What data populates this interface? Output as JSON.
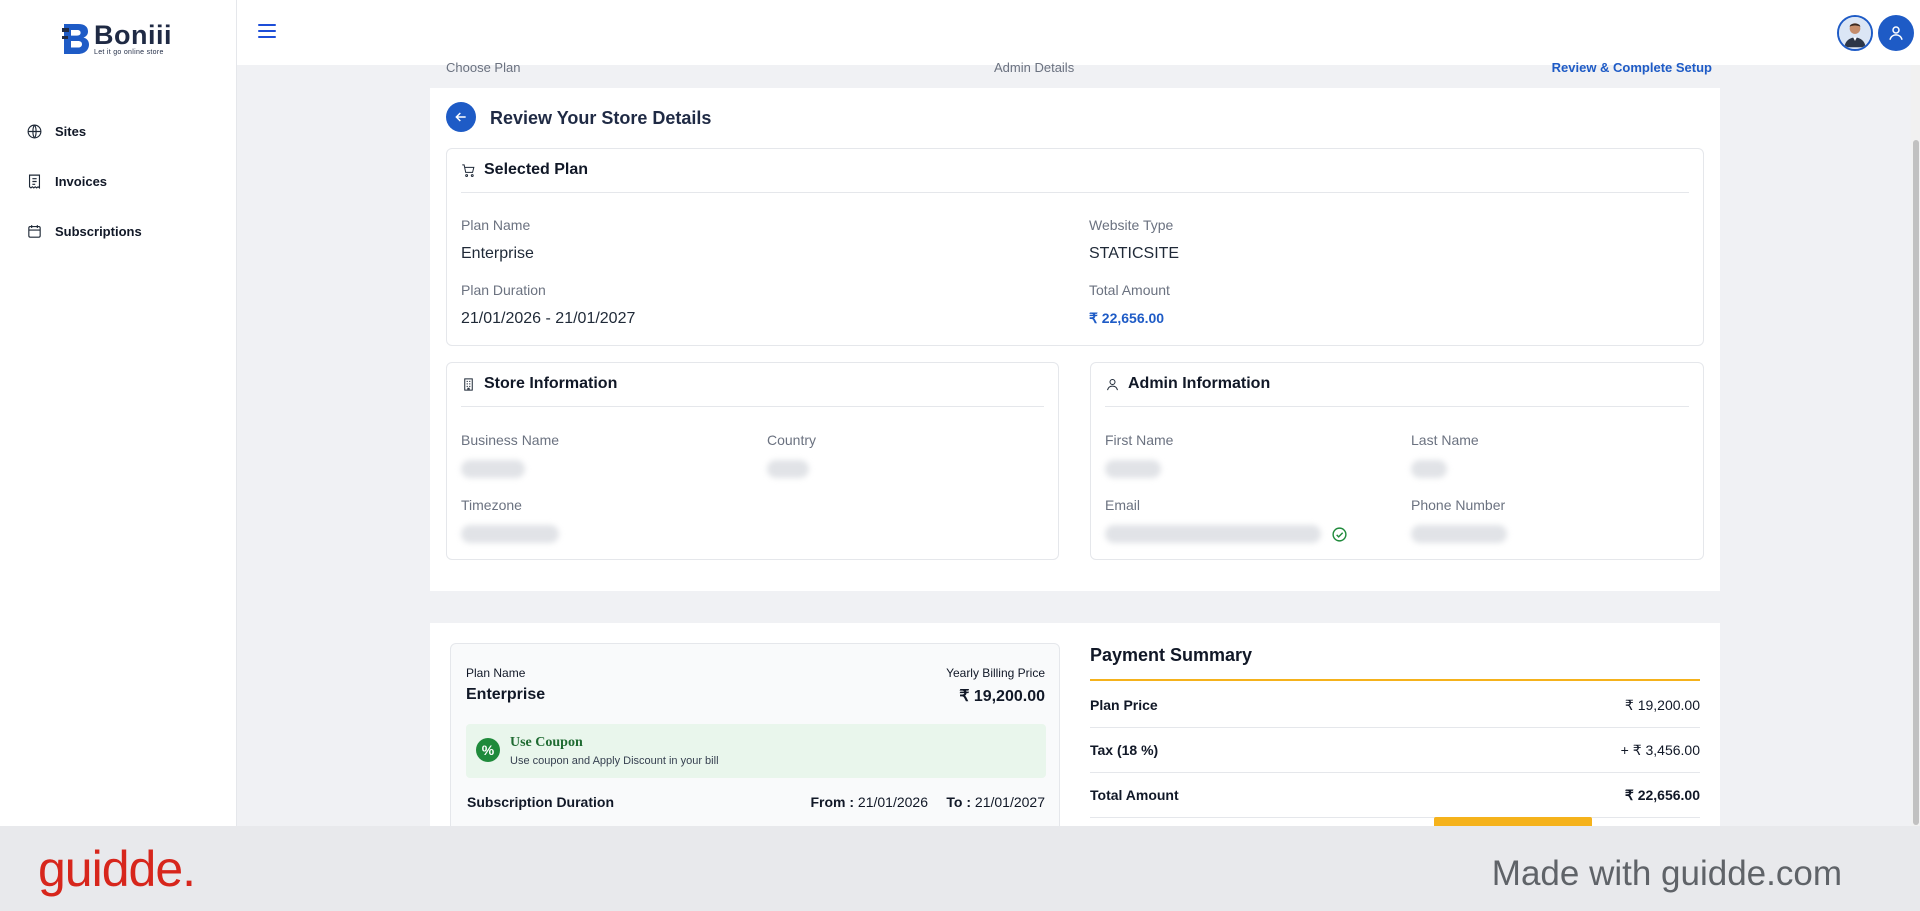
{
  "brand": {
    "name": "Boniii",
    "tagline": "Let it go online store"
  },
  "sidebar": {
    "items": [
      {
        "label": "Sites",
        "icon": "globe-icon"
      },
      {
        "label": "Invoices",
        "icon": "receipt-icon"
      },
      {
        "label": "Subscriptions",
        "icon": "calendar-icon"
      }
    ]
  },
  "stepper": {
    "steps": [
      {
        "label": "Choose Plan"
      },
      {
        "label": "Admin Details"
      },
      {
        "label": "Review & Complete Setup"
      }
    ],
    "active_step": 3
  },
  "review": {
    "title": "Review Your Store Details",
    "selected_plan": {
      "heading": "Selected Plan",
      "plan_name_label": "Plan Name",
      "plan_name": "Enterprise",
      "website_type_label": "Website Type",
      "website_type": "STATICSITE",
      "duration_label": "Plan Duration",
      "duration": "21/01/2026 - 21/01/2027",
      "total_label": "Total Amount",
      "total": "₹ 22,656.00"
    },
    "store_info": {
      "heading": "Store Information",
      "business_name_label": "Business Name",
      "country_label": "Country",
      "timezone_label": "Timezone"
    },
    "admin_info": {
      "heading": "Admin Information",
      "first_name_label": "First Name",
      "last_name_label": "Last Name",
      "email_label": "Email",
      "phone_label": "Phone Number"
    }
  },
  "plan_card": {
    "plan_name_label": "Plan Name",
    "plan_name": "Enterprise",
    "price_label": "Yearly Billing Price",
    "price": "₹ 19,200.00",
    "coupon_title": "Use Coupon",
    "coupon_sub": "Use coupon and Apply Discount in your bill",
    "duration_label": "Subscription Duration",
    "from_label": "From :",
    "from": "21/01/2026",
    "to_label": "To :",
    "to": "21/01/2027"
  },
  "payment_summary": {
    "title": "Payment Summary",
    "rows": [
      {
        "label": "Plan Price",
        "value": "₹ 19,200.00"
      },
      {
        "label": "Tax (18 %)",
        "value": "+ ₹ 3,456.00"
      },
      {
        "label": "Total Amount",
        "value": "₹ 22,656.00"
      }
    ]
  },
  "footer": {
    "logo": "guidde.",
    "made_with": "Made with guidde.com"
  },
  "colors": {
    "primary": "#1e5bc6",
    "accent": "#f5b21b",
    "success": "#1f8a3b",
    "footer_brand": "#d7261c"
  }
}
